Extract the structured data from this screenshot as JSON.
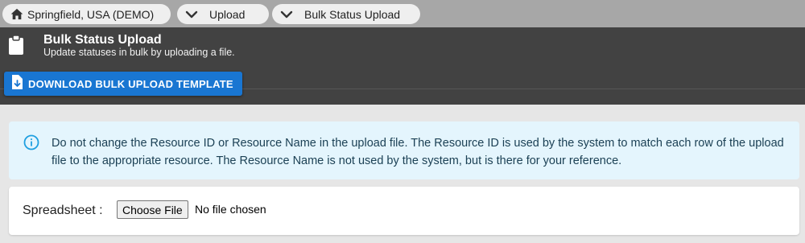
{
  "breadcrumbs": [
    {
      "label": "Springfield, USA (DEMO)",
      "icon": "home-icon"
    },
    {
      "label": "Upload",
      "icon": "chevron-down-icon"
    },
    {
      "label": "Bulk Status Upload",
      "icon": "chevron-down-icon"
    }
  ],
  "header": {
    "icon": "clipboard-icon",
    "title": "Bulk Status Upload",
    "subtitle": "Update statuses in bulk by uploading a file."
  },
  "download_button": {
    "label": "DOWNLOAD BULK UPLOAD TEMPLATE",
    "icon": "file-download-icon",
    "color": "#1976d2"
  },
  "alert": {
    "icon": "info-icon",
    "text": "Do not change the Resource ID or Resource Name in the upload file. The Resource ID is used by the system to match each row of the upload file to the appropriate resource. The Resource Name is not used by the system, but is there for your reference."
  },
  "upload": {
    "label": "Spreadsheet :",
    "button_label": "Choose File",
    "file_status": "No file chosen"
  },
  "colors": {
    "breadcrumb_bar": "#a7a7a7",
    "header_bg": "#424242",
    "alert_bg": "#e4f5fd",
    "info_icon": "#1e9fe0"
  }
}
